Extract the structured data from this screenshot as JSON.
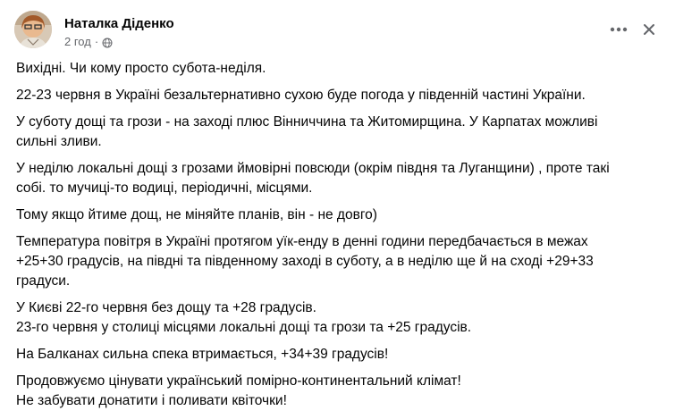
{
  "post": {
    "author": "Наталка Діденко",
    "time": "2 год",
    "separator": "·",
    "icons": {
      "privacy": "globe-icon",
      "more": "more-horizontal-icon",
      "close": "close-icon"
    },
    "paragraphs": [
      [
        "Вихідні. Чи кому просто субота-неділя."
      ],
      [
        "22-23 червня в Україні безальтернативно сухою буде погода у південній частині України."
      ],
      [
        "У суботу дощі та грози - на заході плюс Вінниччина та Житомирщина. У Карпатах можливі",
        "сильні зливи."
      ],
      [
        "У неділю локальні дощі з грозами ймовірні повсюди (окрім півдня та Луганщини) , проте такі",
        "собі. то мучиці-то водиці, періодичні, місцями."
      ],
      [
        "Тому якщо йтиме дощ, не міняйте планів, він - не довго)"
      ],
      [
        "Температура повітря в Україні протягом уїк-енду в денні години передбачається в межах",
        "+25+30 градусів, на півдні та південному заході в суботу, а в неділю ще й на сході +29+33",
        "градуси."
      ],
      [
        "У Києві 22-го червня без дощу та +28 градусів.",
        "23-го червня у столиці місцями локальні дощі та грози та +25 градусів."
      ],
      [
        "На Балканах сильна спека втримається, +34+39 градусів!"
      ],
      [
        "Продовжуємо цінувати український помірно-континентальний клімат!",
        "Не забувати донатити і поливати квіточки!"
      ]
    ]
  }
}
